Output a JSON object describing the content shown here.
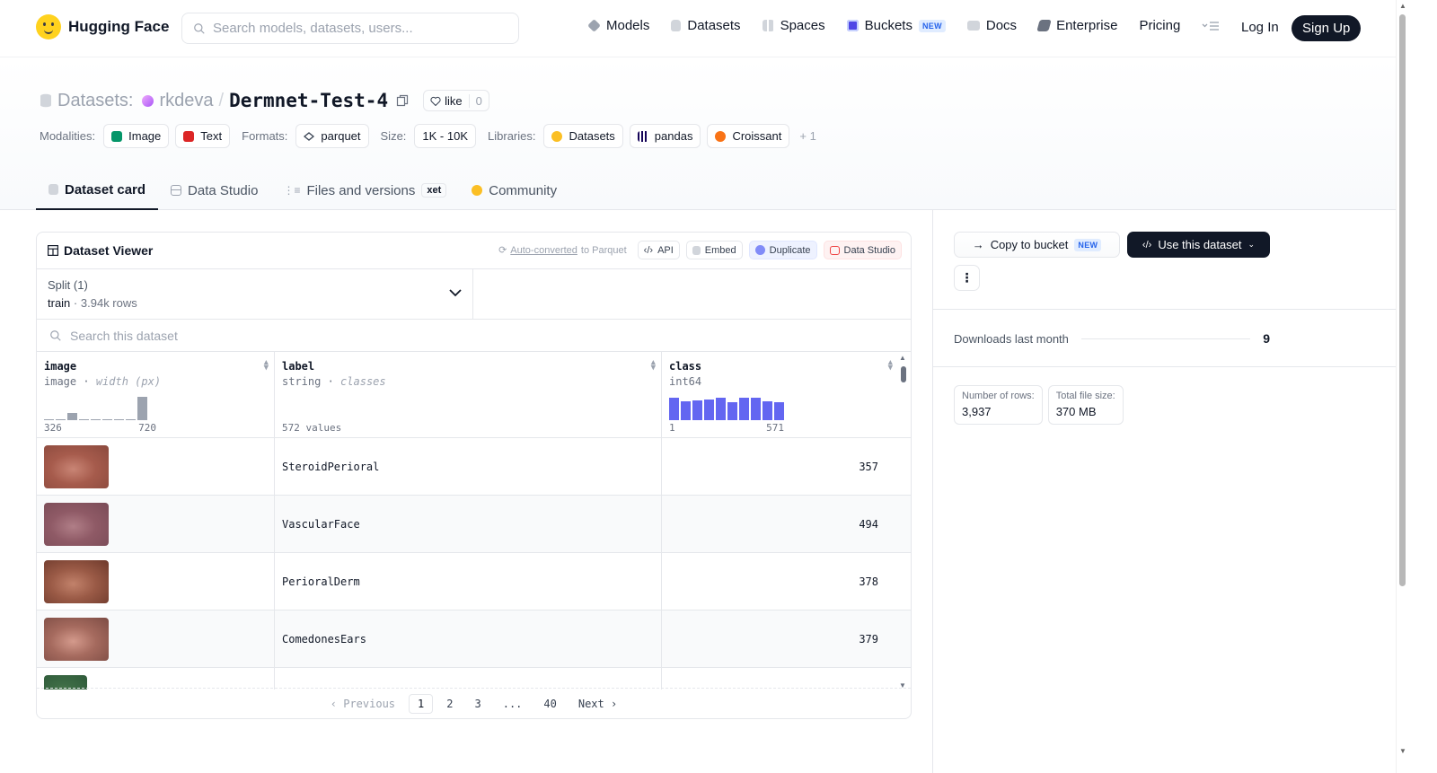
{
  "brand": {
    "name": "Hugging Face"
  },
  "search": {
    "placeholder": "Search models, datasets, users..."
  },
  "nav": {
    "items": [
      {
        "label": "Models",
        "icon": "models-icon",
        "color": "#9ca3af"
      },
      {
        "label": "Datasets",
        "icon": "datasets-icon",
        "color": "#d1d5db"
      },
      {
        "label": "Spaces",
        "icon": "spaces-icon",
        "color": "#d1d5db"
      },
      {
        "label": "Buckets",
        "icon": "buckets-icon",
        "color": "#4f46e5",
        "badge": "NEW"
      },
      {
        "label": "Docs",
        "icon": "docs-icon",
        "color": "#d1d5db"
      },
      {
        "label": "Enterprise",
        "icon": "enterprise-icon",
        "color": "#6b7280"
      },
      {
        "label": "Pricing"
      }
    ],
    "login": "Log In",
    "signup": "Sign Up"
  },
  "repo": {
    "type_label": "Datasets:",
    "owner": "rkdeva",
    "separator": "/",
    "name": "Dermnet-Test-4",
    "like_label": "like",
    "like_count": "0"
  },
  "meta": {
    "modalities_label": "Modalities:",
    "modalities": [
      {
        "label": "Image",
        "color": "#059669"
      },
      {
        "label": "Text",
        "color": "#dc2626"
      }
    ],
    "formats_label": "Formats:",
    "format": "parquet",
    "size_label": "Size:",
    "size": "1K - 10K",
    "libraries_label": "Libraries:",
    "libraries": [
      {
        "label": "Datasets",
        "icon": "hf-icon",
        "color": "#fbbf24"
      },
      {
        "label": "pandas",
        "icon": "pandas-icon",
        "color": "#150458"
      },
      {
        "label": "Croissant",
        "icon": "croissant-icon",
        "color": "#f97316"
      }
    ],
    "more": "+ 1"
  },
  "tabs": [
    {
      "label": "Dataset card",
      "active": true
    },
    {
      "label": "Data Studio"
    },
    {
      "label": "Files and versions",
      "badge": "xet"
    },
    {
      "label": "Community"
    }
  ],
  "viewer": {
    "title": "Dataset Viewer",
    "autoconv_link": "Auto-converted",
    "autoconv_rest": "to Parquet",
    "api": "API",
    "embed": "Embed",
    "duplicate": "Duplicate",
    "data_studio": "Data Studio",
    "split_label": "Split (1)",
    "split_value": "train",
    "split_sep": "·",
    "split_rows": "3.94k rows",
    "search_placeholder": "Search this dataset",
    "columns": [
      {
        "name": "image",
        "type": "image",
        "sub": "width (px)",
        "min": "326",
        "max": "720"
      },
      {
        "name": "label",
        "type": "string",
        "sub": "classes",
        "values": "572 values"
      },
      {
        "name": "class",
        "type": "int64",
        "min": "1",
        "max": "571"
      }
    ],
    "image_hist": [
      0.05,
      0.05,
      0.3,
      0.05,
      0.05,
      0.05,
      0.05,
      0.05,
      1.0
    ],
    "class_hist": [
      0.95,
      0.8,
      0.85,
      0.9,
      0.95,
      0.75,
      0.95,
      0.95,
      0.8,
      0.75
    ],
    "rows": [
      {
        "label": "SteroidPerioral",
        "class": "357",
        "thumb": [
          "#8b4a3e",
          "#c98575",
          "#a65b4c"
        ]
      },
      {
        "label": "VascularFace",
        "class": "494",
        "thumb": [
          "#7a4c57",
          "#b07e87",
          "#8f5a66"
        ]
      },
      {
        "label": "PerioralDerm",
        "class": "378",
        "thumb": [
          "#6e3a2c",
          "#c2826b",
          "#9a5a46"
        ]
      },
      {
        "label": "ComedonesEars",
        "class": "379",
        "thumb": [
          "#7d4c44",
          "#d49a8c",
          "#a56a5e"
        ]
      },
      {
        "label": "",
        "class": "",
        "thumb": [
          "#2f5a3a",
          "#5e8a5c",
          "#3c6b44"
        ]
      }
    ],
    "pager": {
      "prev": "Previous",
      "pages": [
        "1",
        "2",
        "3",
        "...",
        "40"
      ],
      "next": "Next"
    }
  },
  "sidebar": {
    "copy_bucket": "Copy to bucket",
    "copy_badge": "NEW",
    "use_dataset": "Use this dataset",
    "kebab": "⋮",
    "downloads_label": "Downloads last month",
    "downloads_value": "9",
    "rows_label": "Number of rows:",
    "rows_value": "3,937",
    "filesize_label": "Total file size:",
    "filesize_value": "370 MB"
  }
}
